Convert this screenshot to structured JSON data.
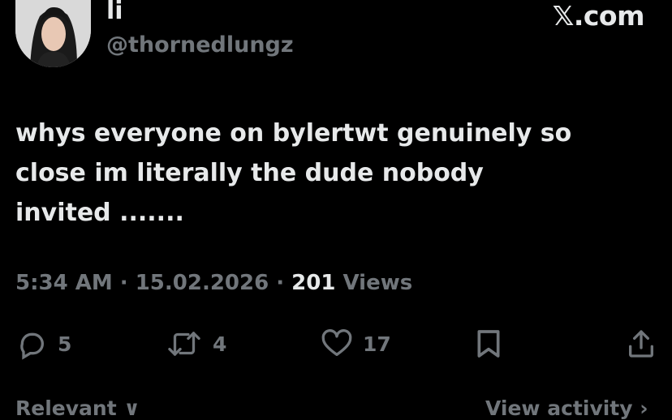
{
  "user": {
    "display_name": "li",
    "handle": "@thornedlungz"
  },
  "brand": {
    "label": "𝕏.com"
  },
  "tweet": {
    "text": "whys everyone on bylertwt genuinely so\nclose im literally the dude nobody\ninvited ......."
  },
  "meta": {
    "time": "5:34 AM",
    "separator_1": " · ",
    "date": "15.02.2026",
    "separator_2": " · ",
    "views_count": "201",
    "views_label": " Views"
  },
  "actions": {
    "replies": {
      "icon": "reply-icon",
      "count": "5"
    },
    "retweets": {
      "icon": "retweet-icon",
      "count": "4"
    },
    "likes": {
      "icon": "heart-icon",
      "count": "17"
    },
    "bookmark": {
      "icon": "bookmark-icon"
    },
    "share": {
      "icon": "share-icon"
    }
  },
  "footer": {
    "sort_label": "Relevant ∨",
    "activity_label": "View activity ›"
  },
  "colors": {
    "background": "#000000",
    "text_primary": "#e7e9ea",
    "text_secondary": "#71767b"
  }
}
